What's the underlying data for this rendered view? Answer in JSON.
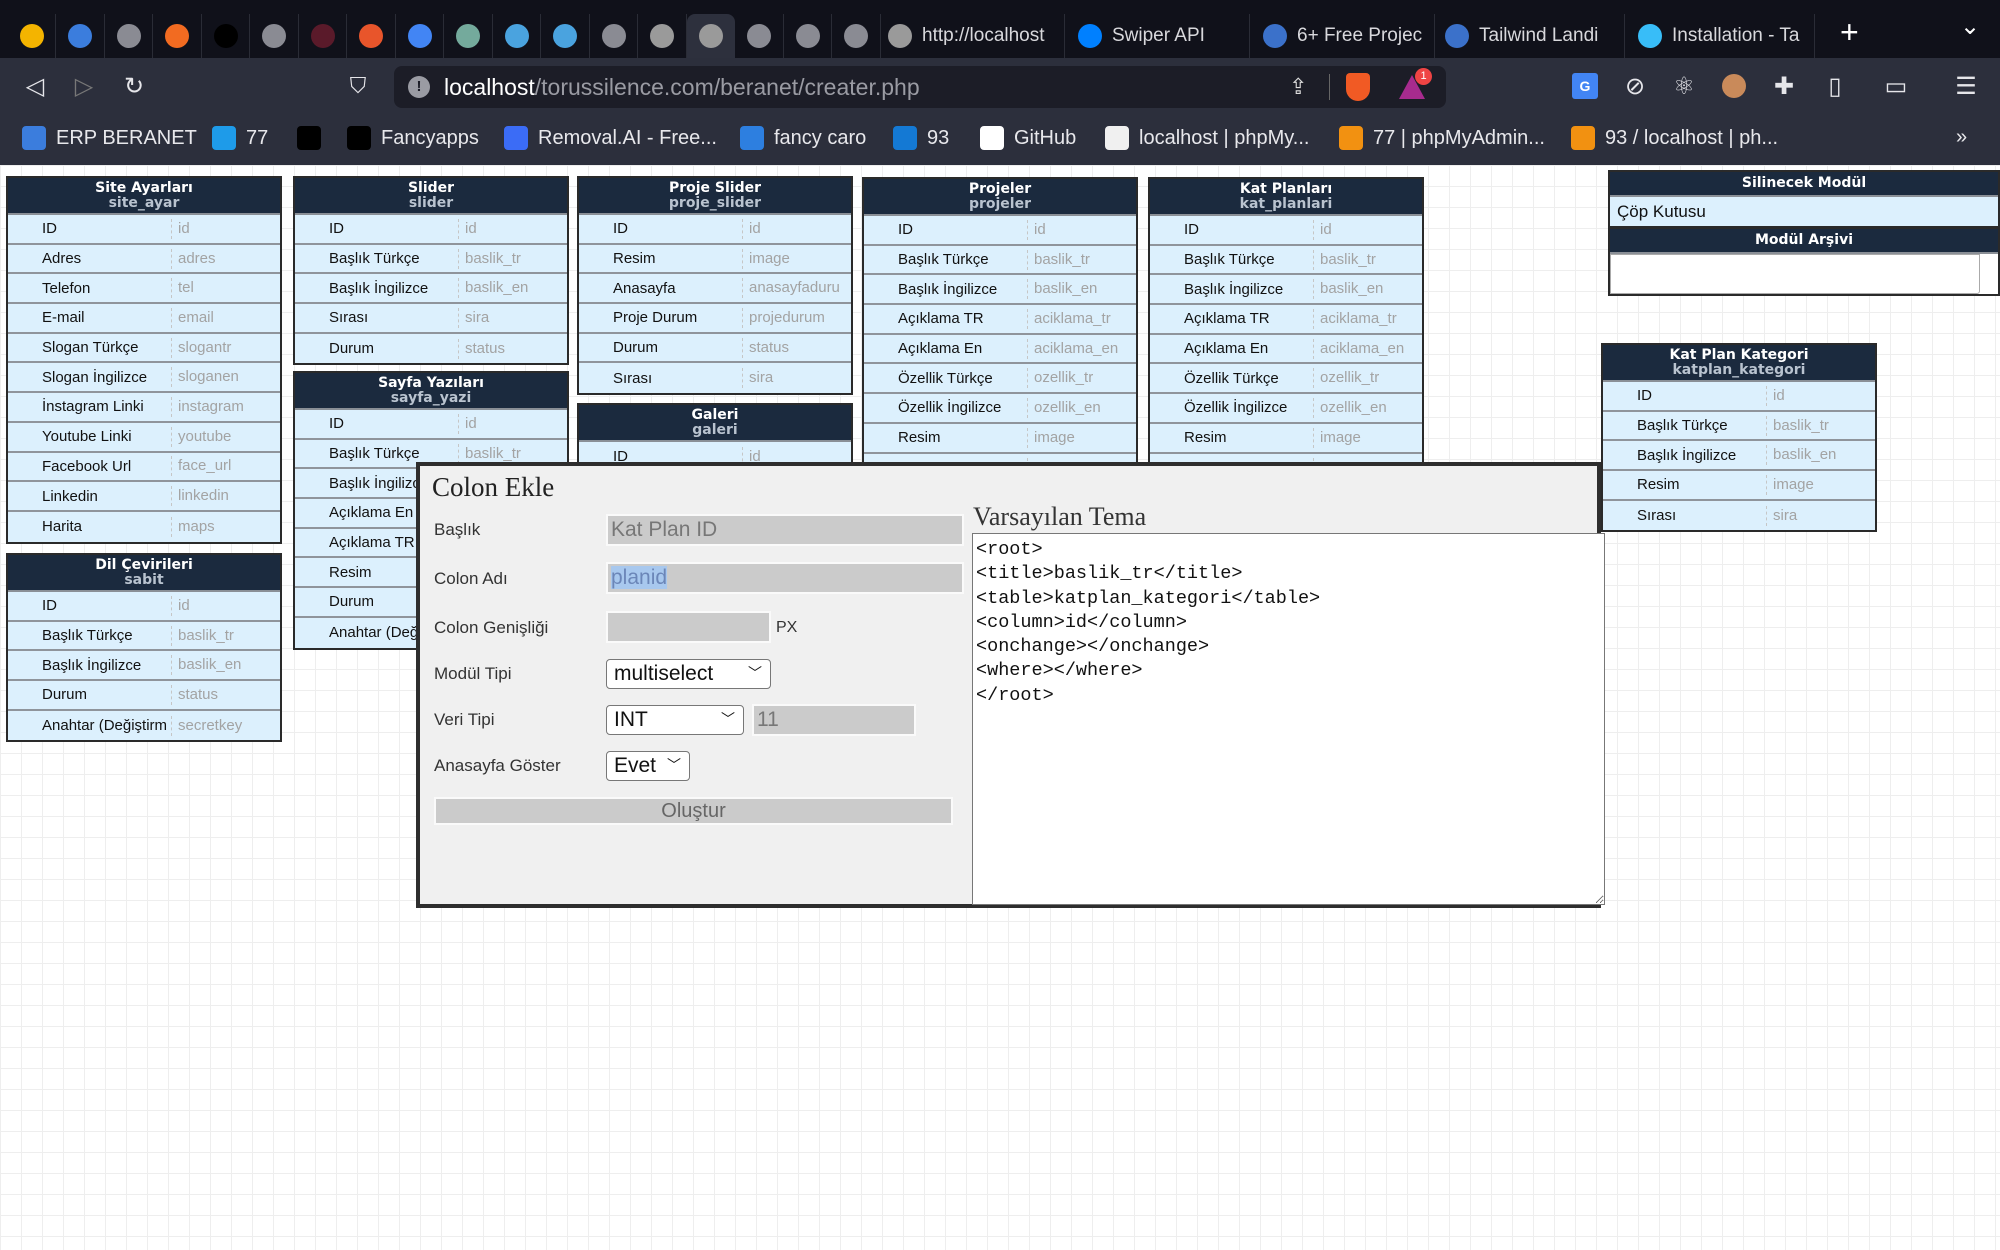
{
  "browser": {
    "favicon_tabs": [
      {
        "icon": "multicolor-logo-icon",
        "color": "#f4b400"
      },
      {
        "icon": "b-logo-icon",
        "color": "#3b7ddd"
      },
      {
        "icon": "globe-icon",
        "color": "#8a8b93"
      },
      {
        "icon": "s-logo-icon",
        "color": "#f26b21"
      },
      {
        "icon": "m-logo-icon",
        "color": "#000000"
      },
      {
        "icon": "globe-icon",
        "color": "#8a8b93"
      },
      {
        "icon": "circle-logo-icon",
        "color": "#5a1a2a"
      },
      {
        "icon": "gitlab-like-icon",
        "color": "#e8552b"
      },
      {
        "icon": "google-translate-icon",
        "color": "#4285f4"
      },
      {
        "icon": "chatgpt-icon",
        "color": "#74aa9c"
      },
      {
        "icon": "app-icon",
        "color": "#4aa3df"
      },
      {
        "icon": "app-icon",
        "color": "#4aa3df"
      },
      {
        "icon": "globe-icon",
        "color": "#8a8b93"
      },
      {
        "icon": "phpmyadmin-elephant-icon",
        "color": "#9a9a9a"
      },
      {
        "icon": "phpmyadmin-elephant-icon",
        "color": "#9a9a9a"
      },
      {
        "icon": "globe-icon",
        "color": "#8a8b93"
      },
      {
        "icon": "globe-icon",
        "color": "#8a8b93"
      },
      {
        "icon": "globe-icon",
        "color": "#8a8b93"
      }
    ],
    "active_tab_index": 14,
    "text_tabs": [
      {
        "label": "http://localhost",
        "icon": "phpmyadmin-elephant-icon",
        "color": "#9a9a9a"
      },
      {
        "label": "Swiper API",
        "icon": "swiper-icon",
        "color": "#0080ff"
      },
      {
        "label": "6+ Free Projec",
        "icon": "te-icon",
        "color": "#3b71ca"
      },
      {
        "label": "Tailwind Landi",
        "icon": "mdb-icon",
        "color": "#3b71ca"
      },
      {
        "label": "Installation - Ta",
        "icon": "tailwind-icon",
        "color": "#38bdf8"
      }
    ],
    "url_host": "localhost",
    "url_path": "/torussilence.com/beranet/creater.php",
    "shields_badge": "1",
    "bookmarks": [
      {
        "label": "ERP BERANET",
        "icon": "b-logo-icon",
        "color": "#3b7ddd"
      },
      {
        "label": "77",
        "icon": "chevrons-icon",
        "color": "#1e9be9"
      },
      {
        "label": "",
        "icon": "a-logo-icon",
        "color": "#000000"
      },
      {
        "label": "Fancyapps",
        "icon": "tuxedo-icon",
        "color": "#000000"
      },
      {
        "label": "Removal.AI - Free...",
        "icon": "removal-ai-icon",
        "color": "#3b6cf6"
      },
      {
        "label": "fancy caro",
        "icon": "cloud-icon",
        "color": "#2d7fe0"
      },
      {
        "label": "93",
        "icon": "blue-circle-icon",
        "color": "#1479d4"
      },
      {
        "label": "GitHub",
        "icon": "github-icon",
        "color": "#ffffff"
      },
      {
        "label": "localhost | phpMy...",
        "icon": "pma-icon",
        "color": "#f0f0f0"
      },
      {
        "label": "77 | phpMyAdmin...",
        "icon": "pma-icon",
        "color": "#f29111"
      },
      {
        "label": "93 / localhost | ph...",
        "icon": "pma-icon",
        "color": "#f29111"
      }
    ],
    "more_bookmarks": "»"
  },
  "tables": [
    {
      "title": "Site Ayarları",
      "name": "site_ayar",
      "rows": [
        [
          "ID",
          "id"
        ],
        [
          "Adres",
          "adres"
        ],
        [
          "Telefon",
          "tel"
        ],
        [
          "E-mail",
          "email"
        ],
        [
          "Slogan Türkçe",
          "slogantr"
        ],
        [
          "Slogan İngilizce",
          "sloganen"
        ],
        [
          "İnstagram Linki",
          "instagram"
        ],
        [
          "Youtube Linki",
          "youtube"
        ],
        [
          "Facebook Url",
          "face_url"
        ],
        [
          "Linkedin",
          "linkedin"
        ],
        [
          "Harita",
          "maps"
        ]
      ]
    },
    {
      "title": "Dil Çevirileri",
      "name": "sabit",
      "rows": [
        [
          "ID",
          "id"
        ],
        [
          "Başlık Türkçe",
          "baslik_tr"
        ],
        [
          "Başlık İngilizce",
          "baslik_en"
        ],
        [
          "Durum",
          "status"
        ],
        [
          "Anahtar (Değiştirm",
          "secretkey"
        ]
      ]
    },
    {
      "title": "Slider",
      "name": "slider",
      "rows": [
        [
          "ID",
          "id"
        ],
        [
          "Başlık Türkçe",
          "baslik_tr"
        ],
        [
          "Başlık İngilizce",
          "baslik_en"
        ],
        [
          "Sırası",
          "sira"
        ],
        [
          "Durum",
          "status"
        ]
      ]
    },
    {
      "title": "Sayfa Yazıları",
      "name": "sayfa_yazi",
      "rows": [
        [
          "ID",
          "id"
        ],
        [
          "Başlık Türkçe",
          "baslik_tr"
        ],
        [
          "Başlık İngilizce",
          ""
        ],
        [
          "Açıklama En",
          ""
        ],
        [
          "Açıklama TR",
          ""
        ],
        [
          "Resim",
          ""
        ],
        [
          "Durum",
          ""
        ],
        [
          "Anahtar (Değiştirme",
          ""
        ]
      ]
    },
    {
      "title": "Proje Slider",
      "name": "proje_slider",
      "rows": [
        [
          "ID",
          "id"
        ],
        [
          "Resim",
          "image"
        ],
        [
          "Anasayfa",
          "anasayfaduru"
        ],
        [
          "Proje Durum",
          "projedurum"
        ],
        [
          "Durum",
          "status"
        ],
        [
          "Sırası",
          "sira"
        ]
      ]
    },
    {
      "title": "Galeri",
      "name": "galeri",
      "rows": [
        [
          "ID",
          "id"
        ]
      ]
    },
    {
      "title": "Projeler",
      "name": "projeler",
      "rows": [
        [
          "ID",
          "id"
        ],
        [
          "Başlık Türkçe",
          "baslik_tr"
        ],
        [
          "Başlık İngilizce",
          "baslik_en"
        ],
        [
          "Açıklama TR",
          "aciklama_tr"
        ],
        [
          "Açıklama En",
          "aciklama_en"
        ],
        [
          "Özellik Türkçe",
          "ozellik_tr"
        ],
        [
          "Özellik İngilizce",
          "ozellik_en"
        ],
        [
          "Resim",
          "image"
        ],
        [
          "",
          ""
        ]
      ]
    },
    {
      "title": "Kat Planları",
      "name": "kat_planlari",
      "rows": [
        [
          "ID",
          "id"
        ],
        [
          "Başlık Türkçe",
          "baslik_tr"
        ],
        [
          "Başlık İngilizce",
          "baslik_en"
        ],
        [
          "Açıklama TR",
          "aciklama_tr"
        ],
        [
          "Açıklama En",
          "aciklama_en"
        ],
        [
          "Özellik Türkçe",
          "ozellik_tr"
        ],
        [
          "Özellik İngilizce",
          "ozellik_en"
        ],
        [
          "Resim",
          "image"
        ],
        [
          "",
          ""
        ]
      ]
    },
    {
      "title": "Kat Plan Kategori",
      "name": "katplan_kategori",
      "rows": [
        [
          "ID",
          "id"
        ],
        [
          "Başlık Türkçe",
          "baslik_tr"
        ],
        [
          "Başlık İngilizce",
          "baslik_en"
        ],
        [
          "Resim",
          "image"
        ],
        [
          "Sırası",
          "sira"
        ]
      ]
    }
  ],
  "side": {
    "trash_title": "Silinecek Modül",
    "trash_item": "Çöp Kutusu",
    "archive_title": "Modül Arşivi"
  },
  "modal": {
    "title": "Colon Ekle",
    "baslik_label": "Başlık",
    "baslik_value": "Kat Plan ID",
    "colon_adi_label": "Colon Adı",
    "colon_adi_value": "planid",
    "genislik_label": "Colon Genişliği",
    "genislik_value": "",
    "genislik_unit": "PX",
    "modul_tipi_label": "Modül Tipi",
    "modul_tipi_value": "multiselect",
    "veri_tipi_label": "Veri Tipi",
    "veri_tipi_value": "INT",
    "veri_uzunluk_value": "11",
    "anasayfa_label": "Anasayfa Göster",
    "anasayfa_value": "Evet",
    "submit_label": "Oluştur",
    "tema_title": "Varsayılan Tema",
    "tema_value": "<root>\n<title>baslik_tr</title>\n<table>katplan_kategori</table>\n<column>id</column>\n<onchange></onchange>\n<where></where>\n</root>"
  }
}
